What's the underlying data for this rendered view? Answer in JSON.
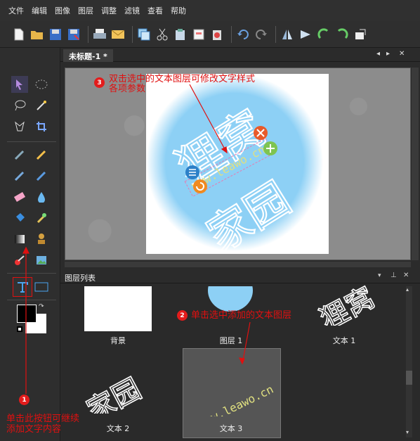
{
  "menu": [
    "文件",
    "编辑",
    "图像",
    "图层",
    "调整",
    "滤镜",
    "查看",
    "帮助"
  ],
  "toolbar_icons": [
    "new-file-icon",
    "open-folder-icon",
    "save-icon",
    "save-as-icon",
    "print-icon",
    "email-icon",
    "copy-icon",
    "cut-icon",
    "paste-icon",
    "paste-into-icon",
    "clear-icon",
    "undo-icon",
    "redo-icon",
    "flip-horizontal-icon",
    "flip-vertical-icon",
    "rotate-left-icon",
    "rotate-right-icon",
    "resize-icon"
  ],
  "document": {
    "tab_title": "未标题-1 *",
    "watermark_top": "狸窝",
    "watermark_bottom": "家园",
    "text_layer": "www.leawo.cn"
  },
  "layers_panel": {
    "title": "图层列表",
    "layers": [
      {
        "name": "背景"
      },
      {
        "name": "图层 1"
      },
      {
        "name": "文本 1"
      },
      {
        "name": "文本 2"
      },
      {
        "name": "文本 3"
      }
    ],
    "thumb_text_1": "狸窝",
    "thumb_text_2": "家园",
    "thumb_text_3": "www.leawo.cn"
  },
  "annotations": {
    "a1_num": "1",
    "a1_text_line1": "单击此按钮可继续",
    "a1_text_line2": "添加文字内容",
    "a2_num": "2",
    "a2_text": "单击选中添加的文本图层",
    "a3_num": "3",
    "a3_text_line1": "双击选中的文本图层可修改文字样式",
    "a3_text_line2": "各项参数"
  },
  "colors": {
    "annotation_red": "#e01010",
    "circle_blue": "#8dd0f5",
    "text_layer_yellow": "#e0e080"
  }
}
